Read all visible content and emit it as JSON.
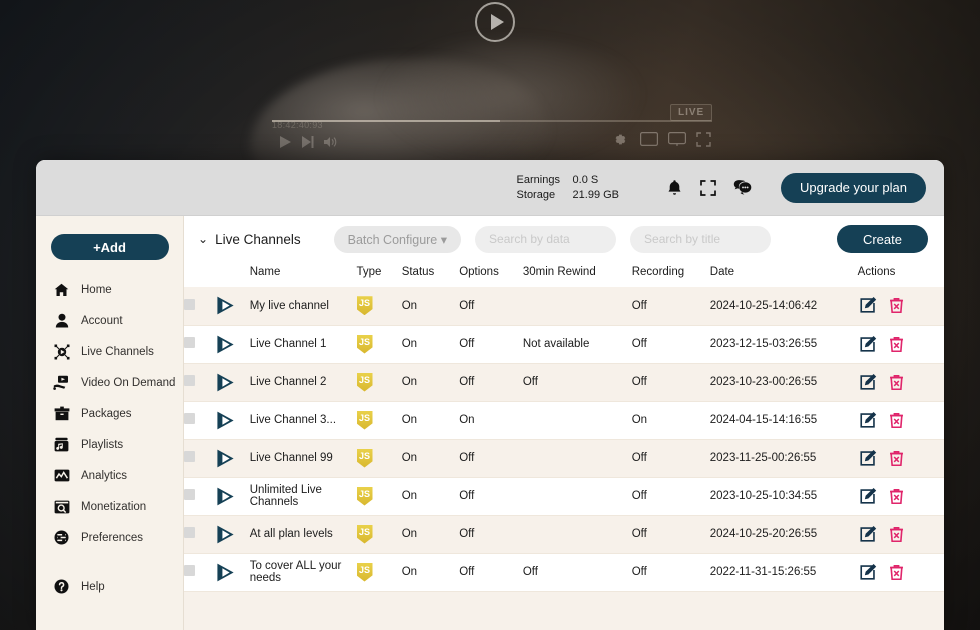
{
  "player": {
    "play_overlay_icon": "play-circle-icon",
    "time_label": "18:42:40:93",
    "live_badge": "LIVE",
    "controls": {
      "play": "play-icon",
      "next": "next-track-icon",
      "volume": "volume-icon",
      "settings": "gear-icon",
      "screen_small": "screen-small-icon",
      "screen_large": "screen-large-icon",
      "fullscreen": "fullscreen-icon"
    }
  },
  "topbar": {
    "earnings_label": "Earnings",
    "earnings_value": "0.0 S",
    "storage_label": "Storage",
    "storage_value": "21.99 GB",
    "notifications_icon": "bell-icon",
    "fullscreen_icon": "fullscreen-icon",
    "chat_icon": "chat-bubble-icon",
    "upgrade_label": "Upgrade your plan"
  },
  "sidebar": {
    "add_label": "+Add",
    "items": [
      {
        "label": "Home",
        "icon": "home-icon"
      },
      {
        "label": "Account",
        "icon": "user-icon"
      },
      {
        "label": "Live Channels",
        "icon": "live-channels-icon"
      },
      {
        "label": "Video On Demand",
        "icon": "video-on-demand-icon"
      },
      {
        "label": "Packages",
        "icon": "package-icon"
      },
      {
        "label": "Playlists",
        "icon": "playlist-icon"
      },
      {
        "label": "Analytics",
        "icon": "analytics-icon"
      },
      {
        "label": "Monetization",
        "icon": "monetization-icon"
      },
      {
        "label": "Preferences",
        "icon": "preferences-icon"
      }
    ],
    "help": {
      "label": "Help",
      "icon": "help-icon"
    }
  },
  "toolbar": {
    "collapse_icon": "chevron-down-icon",
    "section_title": "Live Channels",
    "batch_label": "Batch Configure ▾",
    "search_data_placeholder": "Search by data",
    "search_data_value": "",
    "search_title_placeholder": "Search by title",
    "search_title_value": "",
    "create_label": "Create"
  },
  "table": {
    "columns": [
      "",
      "",
      "Name",
      "Type",
      "Status",
      "Options",
      "30min Rewind",
      "Recording",
      "Date",
      "Actions"
    ],
    "headers": {
      "name": "Name",
      "type": "Type",
      "status": "Status",
      "options": "Options",
      "rewind": "30min Rewind",
      "recording": "Recording",
      "date": "Date",
      "actions": "Actions"
    },
    "type_badge_text": "JS",
    "row_play_icon": "play-icon",
    "edit_icon": "edit-icon",
    "delete_icon": "delete-icon",
    "rows": [
      {
        "name": "My live channel",
        "type": "JS",
        "status": "On",
        "options": "Off",
        "rewind": "",
        "recording": "Off",
        "date": "2024-10-25-14:06:42"
      },
      {
        "name": "Live Channel 1",
        "type": "JS",
        "status": "On",
        "options": "Off",
        "rewind": "Not available",
        "recording": "Off",
        "date": "2023-12-15-03:26:55"
      },
      {
        "name": "Live Channel 2",
        "type": "JS",
        "status": "On",
        "options": "Off",
        "rewind": "Off",
        "recording": "Off",
        "date": "2023-10-23-00:26:55"
      },
      {
        "name": "Live Channel 3...",
        "type": "JS",
        "status": "On",
        "options": "On",
        "rewind": "",
        "recording": "On",
        "date": "2024-04-15-14:16:55"
      },
      {
        "name": "Live Channel 99",
        "type": "JS",
        "status": "On",
        "options": "Off",
        "rewind": "",
        "recording": "Off",
        "date": "2023-11-25-00:26:55"
      },
      {
        "name": "Unlimited Live Channels",
        "type": "JS",
        "status": "On",
        "options": "Off",
        "rewind": "",
        "recording": "Off",
        "date": "2023-10-25-10:34:55"
      },
      {
        "name": "At all plan levels",
        "type": "JS",
        "status": "On",
        "options": "Off",
        "rewind": "",
        "recording": "Off",
        "date": "2024-10-25-20:26:55"
      },
      {
        "name": "To cover ALL your needs",
        "type": "JS",
        "status": "On",
        "options": "Off",
        "rewind": "Off",
        "recording": "Off",
        "date": "2022-11-31-15:26:55"
      }
    ]
  },
  "colors": {
    "brand_dark": "#154055",
    "delete_pink": "#e0256b",
    "js_yellow": "#d8b72e",
    "panel_cream": "#f7f1ea",
    "topbar_grey": "#dcdcdc"
  }
}
